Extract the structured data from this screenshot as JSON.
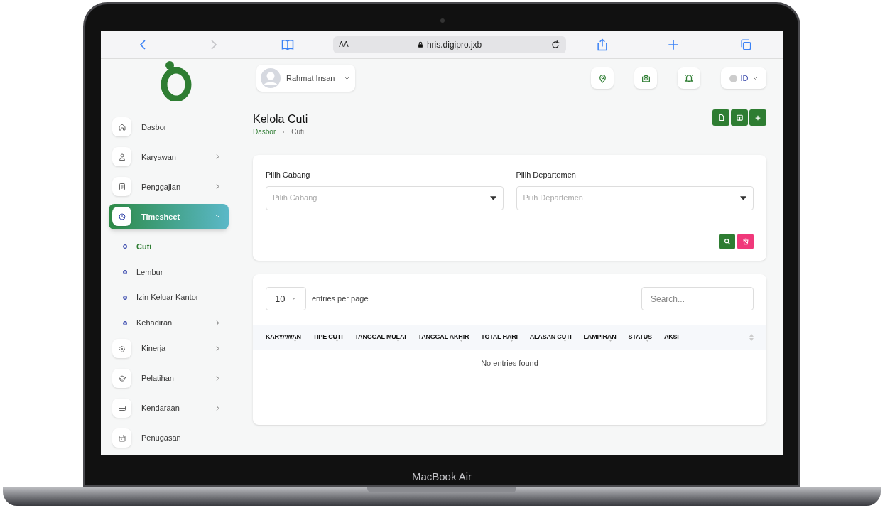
{
  "browser": {
    "text_size": "AA",
    "url": "hris.digipro.jxb"
  },
  "topbar": {
    "user": "Rahmat Insan",
    "language": "ID"
  },
  "sidebar": {
    "items": [
      {
        "label": "Dasbor",
        "has_submenu": false,
        "expanded": false,
        "selected": false
      },
      {
        "label": "Karyawan",
        "has_submenu": true,
        "expanded": false,
        "selected": false
      },
      {
        "label": "Penggajian",
        "has_submenu": true,
        "expanded": false,
        "selected": false
      },
      {
        "label": "Timesheet",
        "has_submenu": true,
        "expanded": true,
        "selected": true,
        "children": [
          {
            "label": "Cuti",
            "has_submenu": false,
            "selected": true
          },
          {
            "label": "Lembur",
            "has_submenu": false,
            "selected": false
          },
          {
            "label": "Izin Keluar Kantor",
            "has_submenu": false,
            "selected": false
          },
          {
            "label": "Kehadiran",
            "has_submenu": true,
            "selected": false
          }
        ]
      },
      {
        "label": "Kinerja",
        "has_submenu": true,
        "expanded": false,
        "selected": false
      },
      {
        "label": "Pelatihan",
        "has_submenu": true,
        "expanded": false,
        "selected": false
      },
      {
        "label": "Kendaraan",
        "has_submenu": true,
        "expanded": false,
        "selected": false
      },
      {
        "label": "Penugasan",
        "has_submenu": false,
        "expanded": false,
        "selected": false
      }
    ]
  },
  "page": {
    "title": "Kelola Cuti",
    "breadcrumb": [
      "Dasbor",
      "Cuti"
    ]
  },
  "filters": [
    {
      "label": "Pilih Cabang",
      "placeholder": "Pilih Cabang"
    },
    {
      "label": "Pilih Departemen",
      "placeholder": "Pilih Departemen"
    }
  ],
  "table": {
    "page_size": "10",
    "entries_label": "entries per page",
    "search_placeholder": "Search...",
    "columns": [
      {
        "label": "KARYAWAN",
        "sortable": true
      },
      {
        "label": "TIPE CUTI",
        "sortable": true
      },
      {
        "label": "TANGGAL MULAI",
        "sortable": true
      },
      {
        "label": "TANGGAL AKHIR",
        "sortable": true
      },
      {
        "label": "TOTAL HARI",
        "sortable": true
      },
      {
        "label": "ALASAN CUTI",
        "sortable": true
      },
      {
        "label": "LAMPIRAN",
        "sortable": true
      },
      {
        "label": "STATUS",
        "sortable": true
      },
      {
        "label": "AKSI",
        "sortable": false
      }
    ],
    "empty_message": "No entries found"
  },
  "device": {
    "label": "MacBook Air"
  }
}
